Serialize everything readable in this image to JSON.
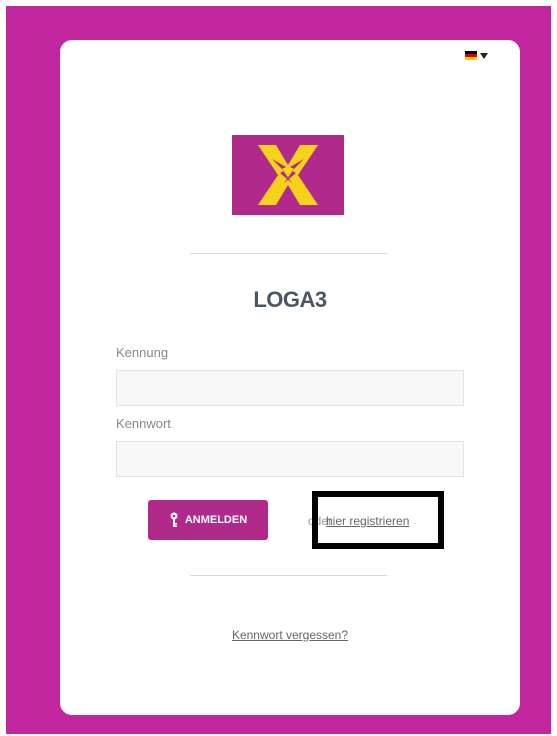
{
  "colors": {
    "background": "#c2269f",
    "accent": "#b02a8c",
    "bolt": "#f6d21c"
  },
  "header": {
    "language_icon": "german-flag-icon",
    "dropdown_icon": "caret-down-icon"
  },
  "logo": {
    "icon": "lightning-x-logo"
  },
  "app": {
    "title": "LOGA3"
  },
  "form": {
    "username_label": "Kennung",
    "username_value": "",
    "password_label": "Kennwort",
    "password_value": ""
  },
  "actions": {
    "login_label": "ANMELDEN",
    "login_icon": "key-icon",
    "or_text": "oder",
    "register_label": "hier registrieren",
    "forgot_label": "Kennwort vergessen?"
  }
}
